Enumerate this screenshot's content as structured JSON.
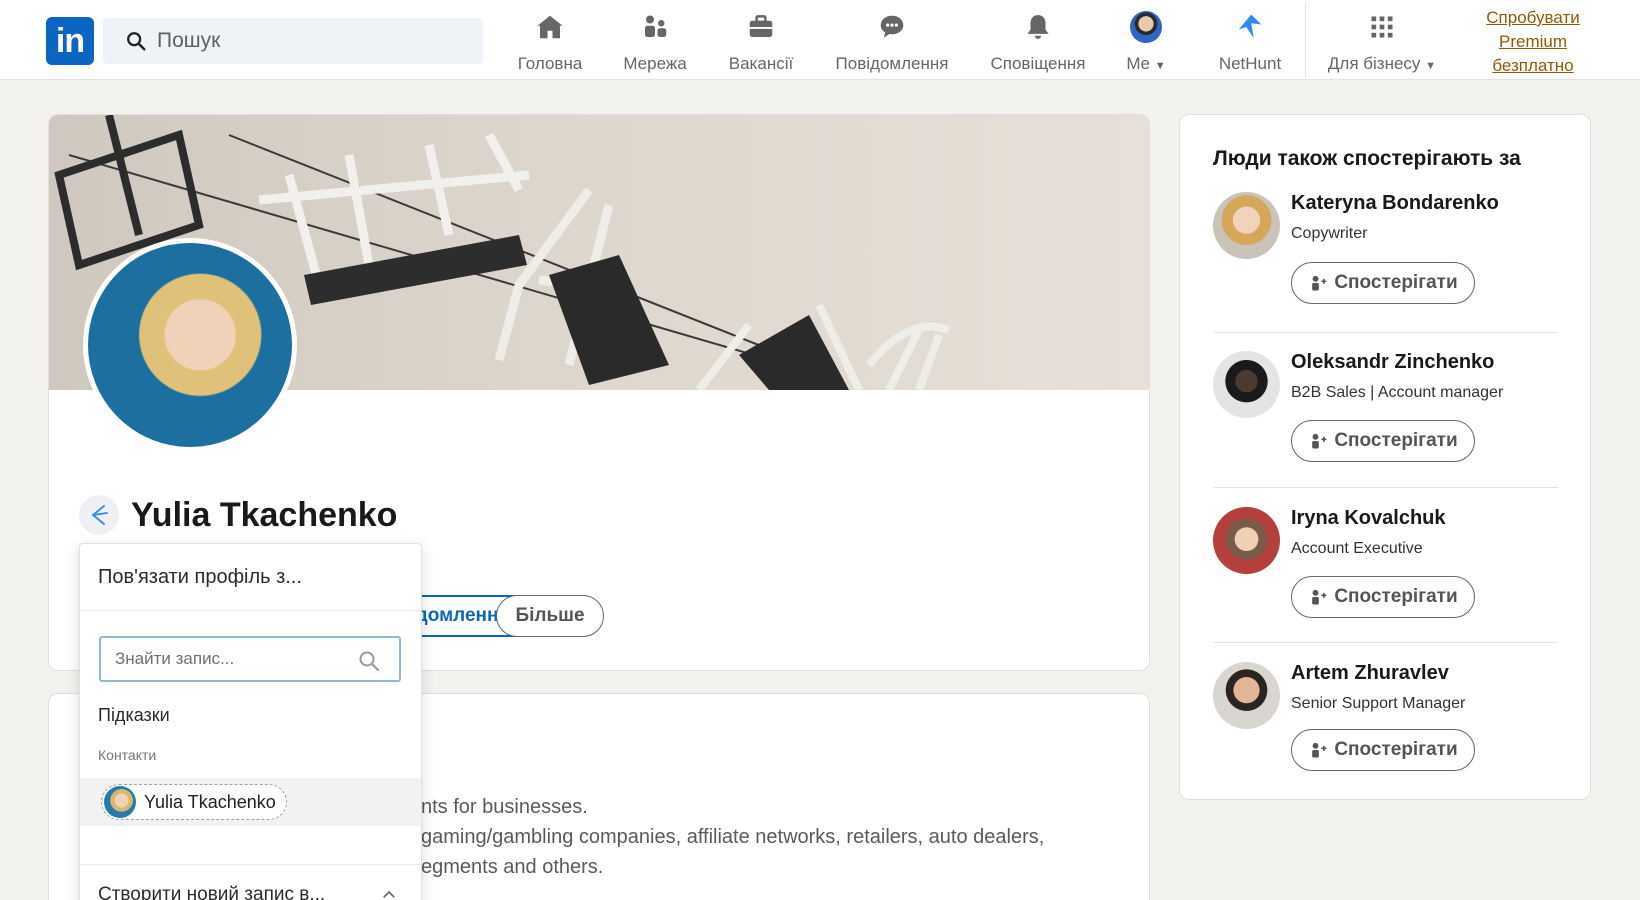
{
  "nav": {
    "search_placeholder": "Пошук",
    "items": [
      {
        "label": "Головна",
        "icon": "home-icon"
      },
      {
        "label": "Мережа",
        "icon": "network-icon"
      },
      {
        "label": "Вакансії",
        "icon": "jobs-icon"
      },
      {
        "label": "Повідомлення",
        "icon": "messaging-icon"
      },
      {
        "label": "Сповіщення",
        "icon": "notifications-icon"
      },
      {
        "label": "Me",
        "icon": "avatar"
      },
      {
        "label": "NetHunt",
        "icon": "nethunt-icon"
      },
      {
        "label": "Для бізнесу",
        "icon": "grid-icon"
      }
    ],
    "premium_line1": "Спробувати",
    "premium_line2": "Premium",
    "premium_line3": "безплатно"
  },
  "profile": {
    "name": "Yulia Tkachenko",
    "message_button": "Повідомлення",
    "more_button": "Більше"
  },
  "about": {
    "line1": "nts for businesses.",
    "line2": "gaming/gambling companies, affiliate networks, retailers, auto dealers,",
    "line3": "egments and others."
  },
  "nethunt_dropdown": {
    "title": "Пов'язати профіль з...",
    "search_placeholder": "Знайти запис...",
    "hints_label": "Підказки",
    "contacts_label": "Контакти",
    "contact_name": "Yulia Tkachenko",
    "create_label": "Створити новий запис в..."
  },
  "rail": {
    "title": "Люди також спостерігають за",
    "people": [
      {
        "name": "Kateryna Bondarenko",
        "title": "Copywriter",
        "button": "Спостерігати"
      },
      {
        "name": "Oleksandr Zinchenko",
        "title": "B2B Sales | Account manager",
        "button": "Спостерігати"
      },
      {
        "name": "Iryna Kovalchuk",
        "title": "Account Executive",
        "button": "Спостерігати"
      },
      {
        "name": "Artem Zhuravlev",
        "title": "Senior Support Manager",
        "button": "Спостерігати"
      }
    ]
  },
  "colors": {
    "brand": "#0a66c2",
    "premium": "#915907",
    "page_bg": "#f3f2ef"
  }
}
